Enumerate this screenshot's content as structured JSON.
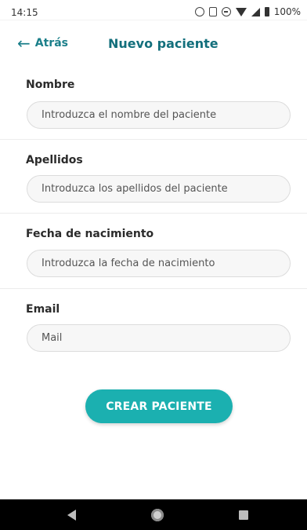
{
  "status_bar": {
    "time": "14:15",
    "battery_text": "100%"
  },
  "header": {
    "back_label": "Atrás",
    "title": "Nuevo paciente"
  },
  "form": {
    "fields": [
      {
        "label": "Nombre",
        "placeholder": "Introduzca el nombre del paciente",
        "value": ""
      },
      {
        "label": "Apellidos",
        "placeholder": "Introduzca los apellidos del paciente",
        "value": ""
      },
      {
        "label": "Fecha de nacimiento",
        "placeholder": "Introduzca la fecha de nacimiento",
        "value": ""
      },
      {
        "label": "Email",
        "placeholder": "Mail",
        "value": ""
      }
    ],
    "submit_label": "CREAR PACIENTE"
  },
  "colors": {
    "accent": "#1bb0b0",
    "title": "#136f7c",
    "link": "#1b7f8a"
  }
}
